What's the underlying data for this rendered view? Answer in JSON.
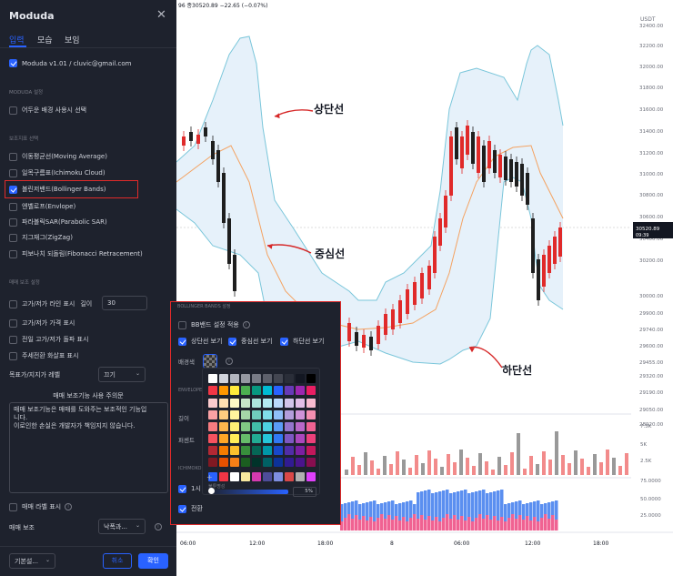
{
  "dialog": {
    "title": "Moduda",
    "tabs": [
      "입력",
      "모습",
      "보임"
    ],
    "account": "Moduda v1.01 / cluvic@gmail.com",
    "section_settings": "MODUDA 설정",
    "dark_bg": "어두운 배경 사용시 선택",
    "section_indicators": "보조지표 선택",
    "indicators": [
      {
        "label": "이동평균선(Moving Average)",
        "checked": false
      },
      {
        "label": "일목구름표(Ichimoku Cloud)",
        "checked": false
      },
      {
        "label": "볼린저밴드(Bollinger Bands)",
        "checked": true
      },
      {
        "label": "엔벨로프(Envlope)",
        "checked": false
      },
      {
        "label": "파라볼릭SAR(Parabolic SAR)",
        "checked": false
      },
      {
        "label": "지그재그(ZigZag)",
        "checked": false
      },
      {
        "label": "피보나치 되돌림(Fibonacci Retracement)",
        "checked": false
      }
    ],
    "section_trade": "매매 보조 설정",
    "highlow_line": "고가/저가 라인 표시",
    "length_label": "길이",
    "length_value": "30",
    "highlow_price": "고가/저가 가격 표시",
    "prev_break": "전일 고가/저가 돌파 표시",
    "week_arrow": "주세전환 화살표 표시",
    "target_level_label": "목표가/지지가 레벨",
    "target_level_value": "끄기",
    "warning_title": "매매 보조기능 사용 주의문",
    "warning_lines": [
      "매매 보조기능은 매매를 도와주는 보조적인 기능입",
      "니다.",
      "이로인한 손실은 개발자가 책임지지 않습니다."
    ],
    "trade_label": "매매 라벨 표시",
    "trade_assist_label": "매매 보조",
    "trade_assist_value": "낙폭과...",
    "footer_template": "기본설...",
    "cancel": "취소",
    "ok": "확인"
  },
  "chart": {
    "header": "96  종30520.89  −22.65 (−0.07%)",
    "currency": "USDT",
    "price_ticks": [
      "32400.00",
      "32200.00",
      "32000.00",
      "31800.00",
      "31600.00",
      "31400.00",
      "31200.00",
      "31000.00",
      "30800.00",
      "30600.00",
      "30400.00",
      "30200.00",
      "30000.00",
      "29900.00",
      "29740.00",
      "29600.00",
      "29455.00",
      "29320.00",
      "29190.00",
      "29050.00",
      "28920.00"
    ],
    "price_tag": "30520.89",
    "price_tag_time": "09:39",
    "volume_ticks": [
      "7.5K",
      "5K",
      "2.5K"
    ],
    "rsi_ticks": [
      "75.0000",
      "50.0000",
      "25.0000"
    ],
    "time_ticks": [
      "06:00",
      "12:00",
      "18:00",
      "8",
      "06:00",
      "12:00",
      "18:00"
    ]
  },
  "annotations": {
    "upper": "상단선",
    "middle": "중심선",
    "lower": "하단선"
  },
  "popup": {
    "title": "BOLLINGER BANDS 설정",
    "bb_apply": "BB밴드 설정 적용",
    "upper_show": "상단선 보기",
    "middle_show": "중심선 보기",
    "lower_show": "하단선 보기",
    "bg_color": "배경색",
    "envelope": "ENVELOPE",
    "length": "길이",
    "percent": "퍼센트",
    "ichimoku": "ICHIMOKO",
    "opacity_label": "불투명성",
    "opacity_value": "5%",
    "row_a": "1시",
    "row_b": "전환"
  },
  "colors": {
    "up": "#26a69a",
    "down": "#ef5350",
    "candle_up": "#e02a2a",
    "candle_down": "#1e1e1e",
    "band": "#7ac6da",
    "middle": "#f4a261",
    "accent": "#2962ff"
  }
}
